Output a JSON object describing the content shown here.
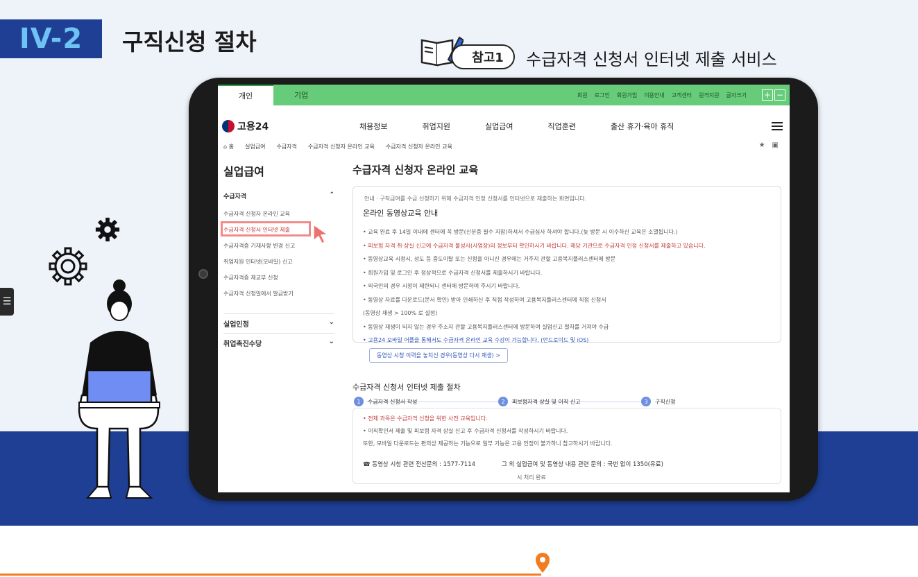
{
  "section": {
    "number": "IV-2",
    "title": "구직신청 절차"
  },
  "reference": {
    "badge": "참고1",
    "title": "수급자격 신청서 인터넷 제출 서비스"
  },
  "site": {
    "tabs": [
      "개인",
      "기업"
    ],
    "utility_links": [
      "회원",
      "로그인",
      "회원가입",
      "이용안내",
      "고객센터",
      "원격지원",
      "글자크기"
    ],
    "logo": "고용24",
    "nav": [
      "채용정보",
      "취업지원",
      "실업급여",
      "직업훈련",
      "출산 휴가·육아 휴직"
    ],
    "breadcrumb": [
      "홈",
      "실업급여",
      "수급자격",
      "수급자격 신청자 온라인 교육",
      "수급자격 신청자 온라인 교육"
    ]
  },
  "sidebar": {
    "title": "실업급여",
    "group": "수급자격",
    "items": [
      "수급자격 신청자 온라인 교육",
      "수급자격 신청서 인터넷 제출",
      "수급자격증 기재사항 변경 신고",
      "취업지원 인터넷(모바일) 신고",
      "수급자격증 재교부 신청",
      "수급자격 신청일에서 발급받기"
    ],
    "menus": [
      "실업인정",
      "취업촉진수당"
    ]
  },
  "main": {
    "title": "수급자격 신청자 온라인 교육",
    "card_note": "안내 · 구직급여를 수급 신청하기 위해 수급자격 인정 신청서를 인터넷으로 제출하는 화면입니다.",
    "card_heading": "온라인 동영상교육 안내",
    "card_lines": [
      "• 교육 완료 후 14일 이내에 센터에 꼭 방문(신분증 필수 지참)하셔서 수급심사 하셔야 합니다.(늦 방문 시 이수하신 교육은 소멸됩니다.)",
      "• 피보험 자격 취·상실 신고에 수급자격 불성사(사업장)의 정보부터 확인하시기 바랍니다. 해당 기관으로 수급자격 인정 신청서를 제출하고 있습니다.",
      "• 동영상교육 시청시, 성도 등 중도이탈 또는 신청을 아니신 경우에는 거주지 관할 고용복지플러스센터에 방문",
      "• 회원가입 및 로그인 후 정상적으로 수급자격 신청서를 제출하시기 바랍니다.",
      "• 외국인의 경우 시청이 제한되니 센터에 방문하여 주시기 바랍니다.",
      "• 동영상 자료를 다운로드(문서 확인) 받아 인쇄하신 후 직접 작성하여 고용복지플러스센터에 직접 신청서",
      "  (동영상 재생 > 100% 로 설정)",
      "• 동영상 재생이 되지 않는 경우 주소지 관할 고용복지플러스센터에 방문하여 실업신고 절차를 거쳐야 수급",
      "• 고용24 모바일 어플을 통해서도 수급자격 온라인 교육 수강이 가능합니다. (안드로이드 및 iOS)"
    ],
    "card_button": "동영상 시청 이력을 놓치신 경우(동영상 다시 재생) >",
    "process_title": "수급자격 신청서 인터넷 제출 절차",
    "steps": [
      "수급자격 신청서 작성",
      "피보험자격 상실 및 이직 신고",
      "구직신청"
    ],
    "process_lines": [
      "• 전체 과목은 수급자격 신청을 위한 사전 교육입니다.",
      "• 이직확인서 제출 및 피보험 자격 상실 신고 후 수급자격 신청서를 작성하시기 바랍니다.",
      "  또한, 모바일 다운로드는 편의상 제공하는 기능으로 일부 기능은 고용 인정이 불가하니 참고하시기 바랍니다."
    ],
    "phone": "☎ 동영상 시청 관련 전산문의 : 1577-7114",
    "phone_note": "그 외 실업급여 및 동영상 내용 관련 문의 : 국번 없이 1350(유료)",
    "process_footer": "시 처리 완료"
  }
}
